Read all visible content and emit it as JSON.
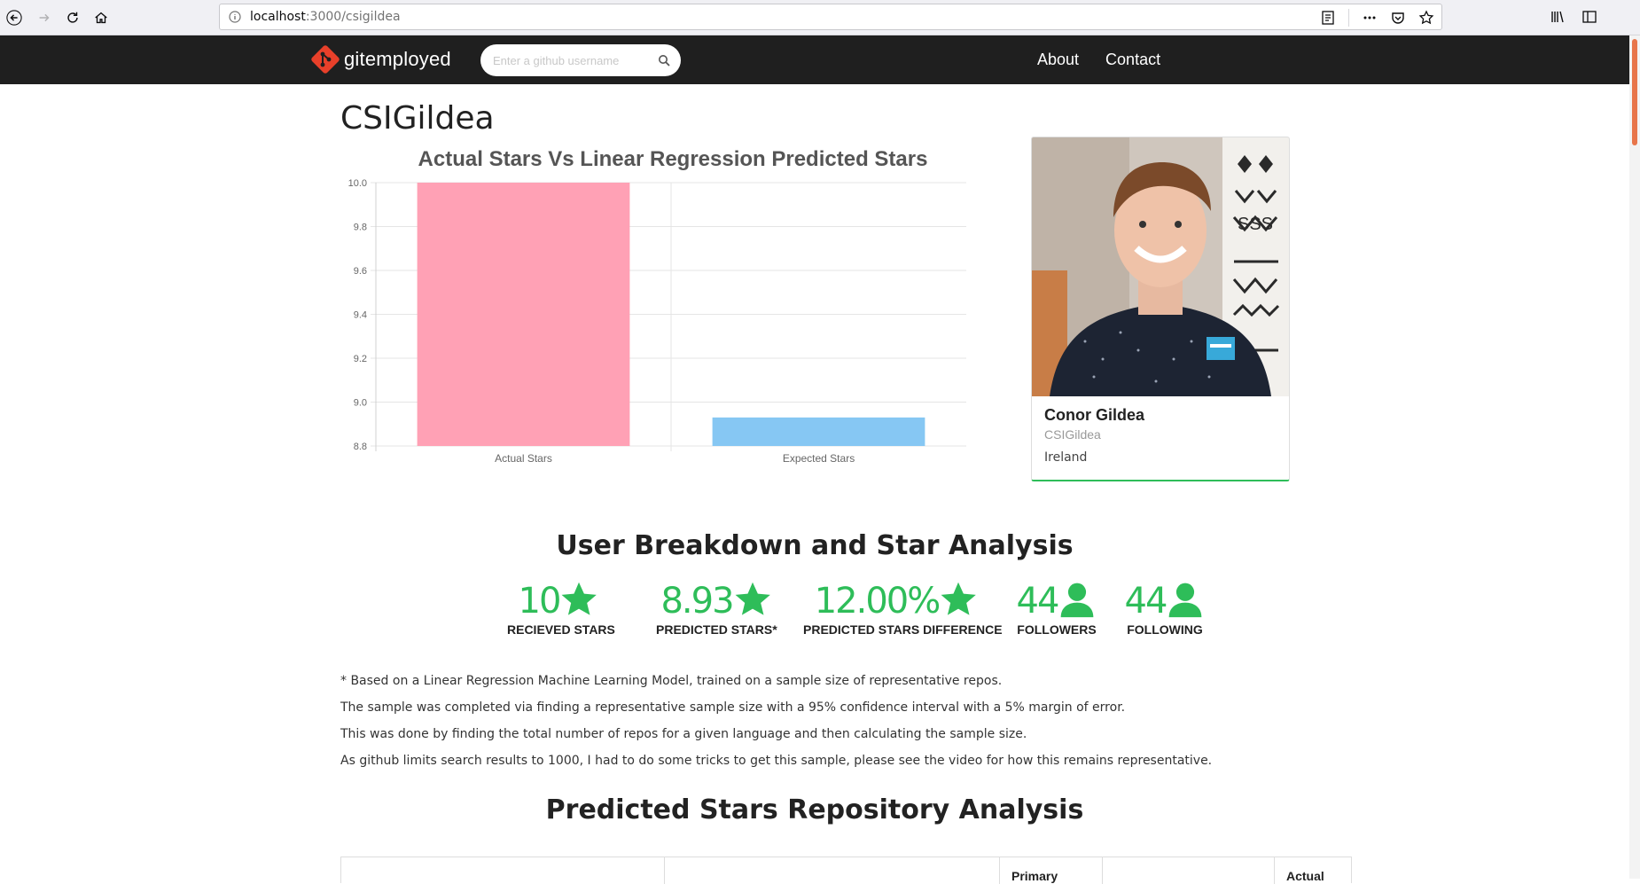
{
  "browser": {
    "url_host": "localhost",
    "url_path": ":3000/csigildea"
  },
  "nav": {
    "brand": "gitemployed",
    "search_placeholder": "Enter a github username",
    "links": [
      "About",
      "Contact"
    ]
  },
  "page": {
    "title": "CSIGildea"
  },
  "chart_data": {
    "type": "bar",
    "title": "Actual Stars Vs Linear Regression Predicted Stars",
    "categories": [
      "Actual Stars",
      "Expected Stars"
    ],
    "values": [
      10,
      8.93
    ],
    "colors": [
      "#ffa1b5",
      "#86c7f3"
    ],
    "ylim": [
      8.8,
      10.0
    ],
    "yticks": [
      "10.0",
      "9.8",
      "9.6",
      "9.4",
      "9.2",
      "9.0",
      "8.8"
    ],
    "grid": true
  },
  "profile": {
    "name": "Conor Gildea",
    "login": "CSIGildea",
    "location": "Ireland"
  },
  "breakdown": {
    "title": "User Breakdown and Star Analysis",
    "stats": [
      {
        "value": "10",
        "icon": "star-icon",
        "label": "RECIEVED STARS"
      },
      {
        "value": "8.93",
        "icon": "star-icon",
        "label": "PREDICTED STARS*"
      },
      {
        "value": "12.00%",
        "icon": "star-icon",
        "label": "PREDICTED STARS DIFFERENCE"
      },
      {
        "value": "44",
        "icon": "user-icon",
        "label": "FOLLOWERS"
      },
      {
        "value": "44",
        "icon": "user-icon",
        "label": "FOLLOWING"
      }
    ],
    "accent": "#2ebd59"
  },
  "notes": [
    "* Based on a Linear Regression Machine Learning Model, trained on a sample size of representative repos.",
    "The sample was completed via finding a representative sample size with a 95% confidence interval with a 5% margin of error.",
    "This was done by finding the total number of repos for a given language and then calculating the sample size.",
    "As github limits search results to 1000, I had to do some tricks to get this sample, please see the video for how this remains representative."
  ],
  "repo_analysis": {
    "title": "Predicted Stars Repository Analysis",
    "headers": [
      "Primary",
      "Actual"
    ]
  }
}
